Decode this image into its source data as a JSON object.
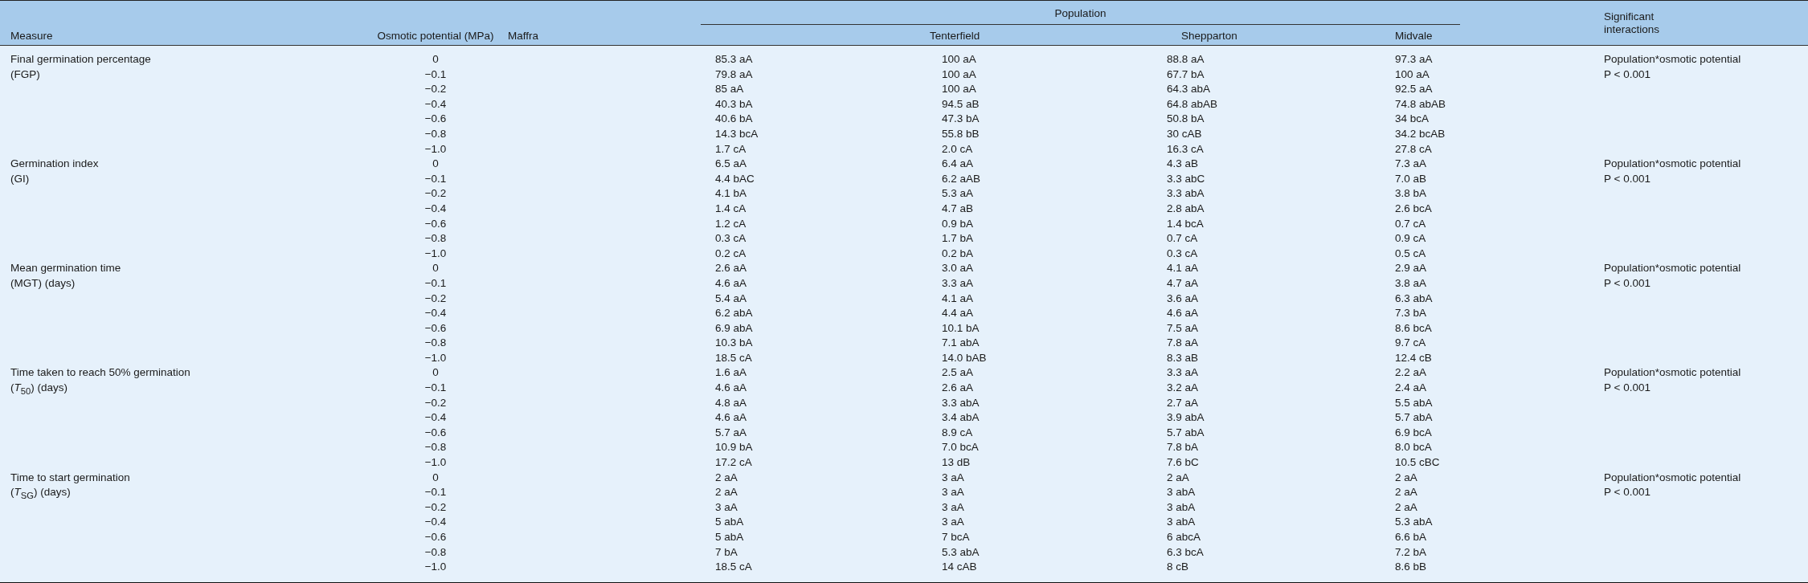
{
  "header": {
    "measure": "Measure",
    "potential": "Osmotic potential (MPa)",
    "group": "Population",
    "populations": [
      "Maffra",
      "Tenterfield",
      "Shepparton",
      "Midvale"
    ],
    "interactions": "Significant\ninteractions"
  },
  "groups": [
    {
      "measure": "Final germination percentage\n(FGP)",
      "interaction": "Population*osmotic potential\nP < 0.001",
      "rows": [
        {
          "potential": "0",
          "values": [
            "85.3 aA",
            "100 aA",
            "88.8 aA",
            "97.3 aA"
          ]
        },
        {
          "potential": "−0.1",
          "values": [
            "79.8 aA",
            "100 aA",
            "67.7 bA",
            "100 aA"
          ]
        },
        {
          "potential": "−0.2",
          "values": [
            "85 aA",
            "100 aA",
            "64.3 abA",
            "92.5 aA"
          ]
        },
        {
          "potential": "−0.4",
          "values": [
            "40.3 bA",
            "94.5 aB",
            "64.8 abAB",
            "74.8 abAB"
          ]
        },
        {
          "potential": "−0.6",
          "values": [
            "40.6 bA",
            "47.3 bA",
            "50.8 bA",
            "34 bcA"
          ]
        },
        {
          "potential": "−0.8",
          "values": [
            "14.3 bcA",
            "55.8 bB",
            "30 cAB",
            "34.2 bcAB"
          ]
        },
        {
          "potential": "−1.0",
          "values": [
            "1.7 cA",
            "2.0 cA",
            "16.3 cA",
            "27.8 cA"
          ]
        }
      ]
    },
    {
      "measure": "Germination index\n(GI)",
      "interaction": "Population*osmotic potential\nP < 0.001",
      "rows": [
        {
          "potential": "0",
          "values": [
            "6.5 aA",
            "6.4 aA",
            "4.3 aB",
            "7.3 aA"
          ]
        },
        {
          "potential": "−0.1",
          "values": [
            "4.4 bAC",
            "6.2 aAB",
            "3.3 abC",
            "7.0 aB"
          ]
        },
        {
          "potential": "−0.2",
          "values": [
            "4.1 bA",
            "5.3 aA",
            "3.3 abA",
            "3.8 bA"
          ]
        },
        {
          "potential": "−0.4",
          "values": [
            "1.4 cA",
            "4.7 aB",
            "2.8 abA",
            "2.6 bcA"
          ]
        },
        {
          "potential": "−0.6",
          "values": [
            "1.2 cA",
            "0.9 bA",
            "1.4 bcA",
            "0.7 cA"
          ]
        },
        {
          "potential": "−0.8",
          "values": [
            "0.3 cA",
            "1.7 bA",
            "0.7 cA",
            "0.9 cA"
          ]
        },
        {
          "potential": "−1.0",
          "values": [
            "0.2 cA",
            "0.2 bA",
            "0.3 cA",
            "0.5 cA"
          ]
        }
      ]
    },
    {
      "measure": "Mean germination time\n(MGT) (days)",
      "interaction": "Population*osmotic potential\nP < 0.001",
      "rows": [
        {
          "potential": "0",
          "values": [
            "2.6 aA",
            "3.0 aA",
            "4.1 aA",
            "2.9 aA"
          ]
        },
        {
          "potential": "−0.1",
          "values": [
            "4.6 aA",
            "3.3 aA",
            "4.7 aA",
            "3.8 aA"
          ]
        },
        {
          "potential": "−0.2",
          "values": [
            "5.4 aA",
            "4.1 aA",
            "3.6 aA",
            "6.3 abA"
          ]
        },
        {
          "potential": "−0.4",
          "values": [
            "6.2 abA",
            "4.4 aA",
            "4.6 aA",
            "7.3 bA"
          ]
        },
        {
          "potential": "−0.6",
          "values": [
            "6.9 abA",
            "10.1 bA",
            "7.5 aA",
            "8.6 bcA"
          ]
        },
        {
          "potential": "−0.8",
          "values": [
            "10.3 bA",
            "7.1 abA",
            "7.8 aA",
            "9.7 cA"
          ]
        },
        {
          "potential": "−1.0",
          "values": [
            "18.5 cA",
            "14.0 bAB",
            "8.3 aB",
            "12.4 cB"
          ]
        }
      ]
    },
    {
      "measure": "Time taken to reach 50% germination\n(*T*$_{50}$) (days)",
      "interaction": "Population*osmotic potential\nP < 0.001",
      "rows": [
        {
          "potential": "0",
          "values": [
            "1.6 aA",
            "2.5 aA",
            "3.3 aA",
            "2.2 aA"
          ]
        },
        {
          "potential": "−0.1",
          "values": [
            "4.6 aA",
            "2.6 aA",
            "3.2 aA",
            "2.4 aA"
          ]
        },
        {
          "potential": "−0.2",
          "values": [
            "4.8 aA",
            "3.3 abA",
            "2.7 aA",
            "5.5 abA"
          ]
        },
        {
          "potential": "−0.4",
          "values": [
            "4.6 aA",
            "3.4 abA",
            "3.9 abA",
            "5.7 abA"
          ]
        },
        {
          "potential": "−0.6",
          "values": [
            "5.7 aA",
            "8.9 cA",
            "5.7 abA",
            "6.9 bcA"
          ]
        },
        {
          "potential": "−0.8",
          "values": [
            "10.9 bA",
            "7.0 bcA",
            "7.8 bA",
            "8.0 bcA"
          ]
        },
        {
          "potential": "−1.0",
          "values": [
            "17.2 cA",
            "13 dB",
            "7.6 bC",
            "10.5 cBC"
          ]
        }
      ]
    },
    {
      "measure": "Time to start germination\n(*T*$_{SG}$) (days)",
      "interaction": "Population*osmotic potential\nP < 0.001",
      "rows": [
        {
          "potential": "0",
          "values": [
            "2 aA",
            "3 aA",
            "2 aA",
            "2 aA"
          ]
        },
        {
          "potential": "−0.1",
          "values": [
            "2 aA",
            "3 aA",
            "3 abA",
            "2 aA"
          ]
        },
        {
          "potential": "−0.2",
          "values": [
            "3 aA",
            "3 aA",
            "3 abA",
            "2 aA"
          ]
        },
        {
          "potential": "−0.4",
          "values": [
            "5 abA",
            "3 aA",
            "3 abA",
            "5.3 abA"
          ]
        },
        {
          "potential": "−0.6",
          "values": [
            "5 abA",
            "7 bcA",
            "6 abcA",
            "6.6 bA"
          ]
        },
        {
          "potential": "−0.8",
          "values": [
            "7 bA",
            "5.3 abA",
            "6.3 bcA",
            "7.2 bA"
          ]
        },
        {
          "potential": "−1.0",
          "values": [
            "18.5 cA",
            "14 cAB",
            "8 cB",
            "8.6 bB"
          ]
        }
      ]
    }
  ]
}
